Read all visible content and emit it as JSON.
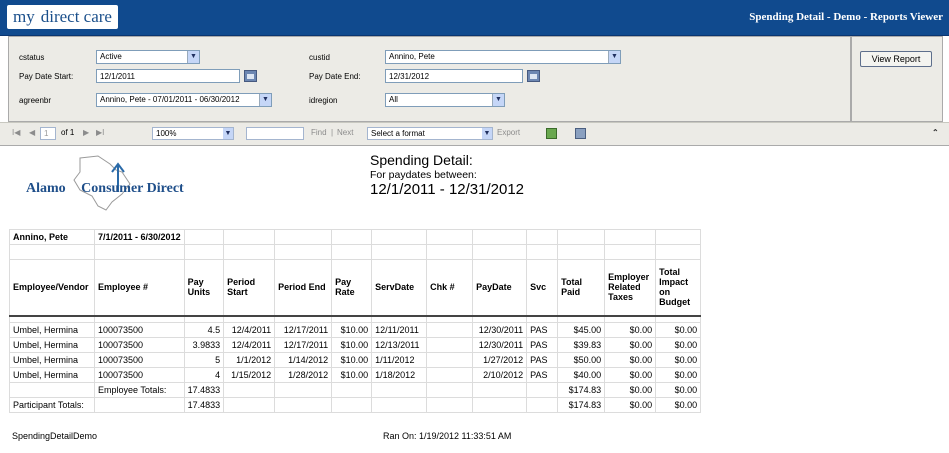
{
  "header": {
    "logo_my": "my",
    "logo_direct": "direct care",
    "title": "Spending Detail - Demo - Reports Viewer"
  },
  "params": {
    "cstatus_label": "cstatus",
    "cstatus_value": "Active",
    "custid_label": "custid",
    "custid_value": "Annino, Pete",
    "pay_date_start_label": "Pay Date Start:",
    "pay_date_start_value": "12/1/2011",
    "pay_date_end_label": "Pay Date End:",
    "pay_date_end_value": "12/31/2012",
    "agreenbr_label": "agreenbr",
    "agreenbr_value": "Annino, Pete - 07/01/2011 - 06/30/2012",
    "idregion_label": "idregion",
    "idregion_value": "All",
    "view_report_label": "View Report"
  },
  "toolbar": {
    "page_value": "1",
    "of_pages": "of 1",
    "zoom": "100%",
    "find_label": "Find",
    "find_sep": "|",
    "next_label": "Next",
    "format_value": "Select a format",
    "export_label": "Export"
  },
  "report": {
    "logo_alamo": "Alamo",
    "logo_consumer": "Consumer Direct",
    "title": "Spending Detail:",
    "subtitle": "For paydates between:",
    "date_range": "12/1/2011 - 12/31/2012",
    "participant": "Annino, Pete",
    "period": "7/1/2011 - 6/30/2012",
    "columns": [
      "Employee/Vendor",
      "Employee #",
      "Pay Units",
      "Period Start",
      "Period End",
      "Pay Rate",
      "ServDate",
      "Chk #",
      "PayDate",
      "Svc",
      "Total Paid",
      "Employer Related Taxes",
      "Total Impact on Budget"
    ],
    "rows": [
      [
        "Umbel, Hermina",
        "100073500",
        "4.5",
        "12/4/2011",
        "12/17/2011",
        "$10.00",
        "12/11/2011",
        "",
        "12/30/2011",
        "PAS",
        "$45.00",
        "$0.00",
        "$0.00"
      ],
      [
        "Umbel, Hermina",
        "100073500",
        "3.9833",
        "12/4/2011",
        "12/17/2011",
        "$10.00",
        "12/13/2011",
        "",
        "12/30/2011",
        "PAS",
        "$39.83",
        "$0.00",
        "$0.00"
      ],
      [
        "Umbel, Hermina",
        "100073500",
        "5",
        "1/1/2012",
        "1/14/2012",
        "$10.00",
        "1/11/2012",
        "",
        "1/27/2012",
        "PAS",
        "$50.00",
        "$0.00",
        "$0.00"
      ],
      [
        "Umbel, Hermina",
        "100073500",
        "4",
        "1/15/2012",
        "1/28/2012",
        "$10.00",
        "1/18/2012",
        "",
        "2/10/2012",
        "PAS",
        "$40.00",
        "$0.00",
        "$0.00"
      ]
    ],
    "employee_totals": {
      "label": "Employee Totals:",
      "units": "17.4833",
      "paid": "$174.83",
      "taxes": "$0.00",
      "impact": "$0.00"
    },
    "participant_totals": {
      "label": "Participant Totals:",
      "units": "17.4833",
      "paid": "$174.83",
      "taxes": "$0.00",
      "impact": "$0.00"
    },
    "report_name": "SpendingDetailDemo",
    "ran_on": "Ran On: 1/19/2012 11:33:51 AM"
  }
}
